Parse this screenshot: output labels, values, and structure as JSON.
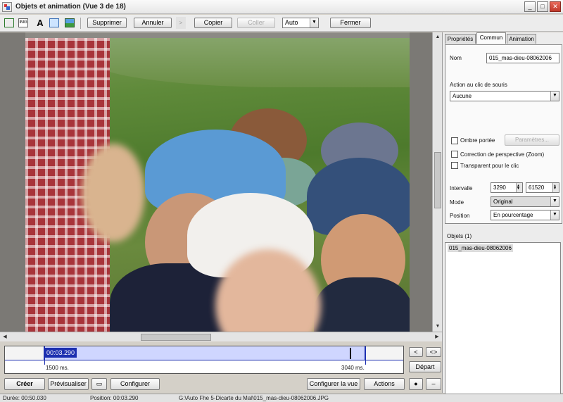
{
  "window": {
    "title": "Objets et animation  (Vue 3 de 18)",
    "minimize": "_",
    "maximize": "□",
    "close": "✕"
  },
  "toolbar": {
    "image_tool_label": "IMG",
    "text_tool_label": "A",
    "delete_label": "Supprimer",
    "undo_label": "Annuler",
    "copy_label": "Copier",
    "paste_label": "Coller",
    "zoom_value": "Auto",
    "close_label": "Fermer"
  },
  "timeline": {
    "position_label": "00:03.290",
    "start_label": "1500 ms.",
    "end_label": "3040 ms.",
    "start_button": "Départ"
  },
  "bottom_buttons": {
    "create": "Créer",
    "preview": "Prévisualiser",
    "configure": "Configurer",
    "configure_view": "Configurer la vue",
    "actions": "Actions"
  },
  "tabs": [
    "Propriétés",
    "Commun",
    "Animation"
  ],
  "panel": {
    "name_label": "Nom",
    "name_value": "015_mas-dieu-08062006",
    "click_action_label": "Action au clic de souris",
    "click_action_value": "Aucune",
    "shadow_label": "Ombre portée",
    "params_button": "Paramètres...",
    "perspective_label": "Correction de perspective (Zoom)",
    "transparent_label": "Transparent pour le clic",
    "interval_label": "Intervalle",
    "interval_from": "3290",
    "interval_to": "61520",
    "mode_label": "Mode",
    "mode_value": "Original",
    "position_label": "Position",
    "position_value": "En pourcentage",
    "objects_title": "Objets (1)",
    "objects": [
      "015_mas-dieu-08062006"
    ]
  },
  "status": {
    "duration": "Durée: 00:50.030",
    "position": "Position: 00:03.290",
    "path": "G:\\Auto Fhe 5-Dicarte du Mal\\015_mas-dieu-08062006.JPG"
  }
}
